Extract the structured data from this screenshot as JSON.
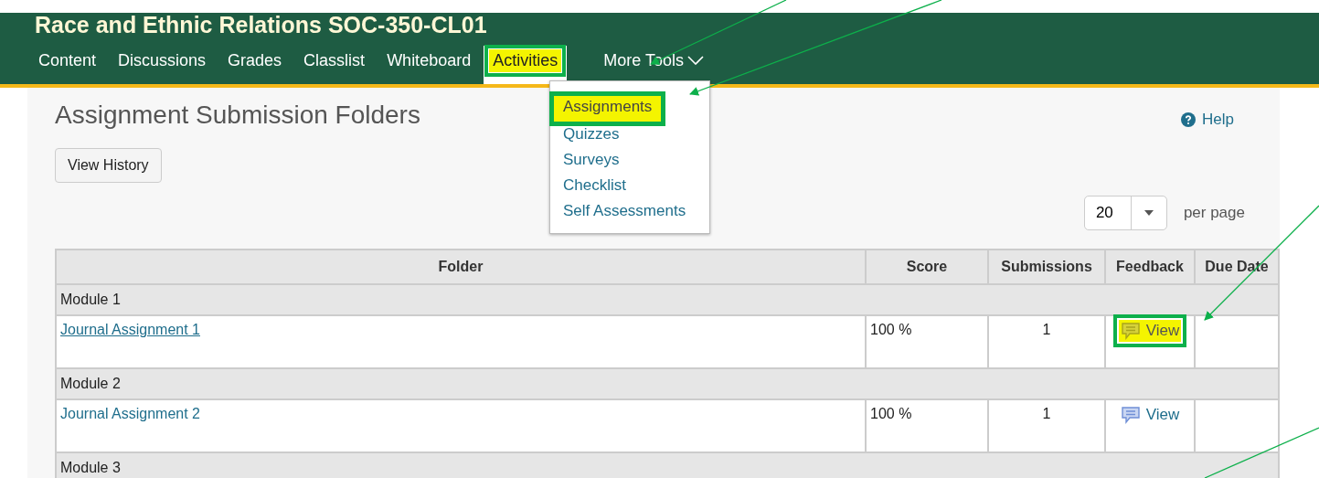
{
  "course_title": "Race and Ethnic Relations SOC-350-CL01",
  "nav": [
    {
      "label": "Content",
      "selected": false,
      "highlighted": false
    },
    {
      "label": "Discussions",
      "selected": false,
      "highlighted": false
    },
    {
      "label": "Grades",
      "selected": false,
      "highlighted": false
    },
    {
      "label": "Classlist",
      "selected": false,
      "highlighted": false
    },
    {
      "label": "Whiteboard",
      "selected": false,
      "highlighted": false
    },
    {
      "label": "Activities",
      "selected": true,
      "highlighted": true
    },
    {
      "label": "More Tools",
      "selected": false,
      "highlighted": false
    }
  ],
  "dropdown": [
    {
      "label": "Assignments",
      "highlighted": true
    },
    {
      "label": "Quizzes",
      "highlighted": false
    },
    {
      "label": "Surveys",
      "highlighted": false
    },
    {
      "label": "Checklist",
      "highlighted": false
    },
    {
      "label": "Self Assessments",
      "highlighted": false
    }
  ],
  "page_title": "Assignment Submission Folders",
  "help": "Help",
  "view_history_button": "View History",
  "pager": {
    "value": "20",
    "label": "per page"
  },
  "table": {
    "columns": [
      "Folder",
      "Score",
      "Submissions",
      "Feedback",
      "Due Date"
    ],
    "rows": [
      {
        "kind": "group",
        "label": "Module 1"
      },
      {
        "kind": "item",
        "folder": "Journal Assignment 1",
        "underlined": true,
        "score": "100 %",
        "submissions": "1",
        "feedback": {
          "label": "View",
          "highlighted": true
        }
      },
      {
        "kind": "group",
        "label": "Module 2"
      },
      {
        "kind": "item",
        "folder": "Journal Assignment 2",
        "underlined": false,
        "score": "100 %",
        "submissions": "1",
        "feedback": {
          "label": "View",
          "highlighted": false
        }
      },
      {
        "kind": "group",
        "label": "Module 3"
      }
    ]
  }
}
